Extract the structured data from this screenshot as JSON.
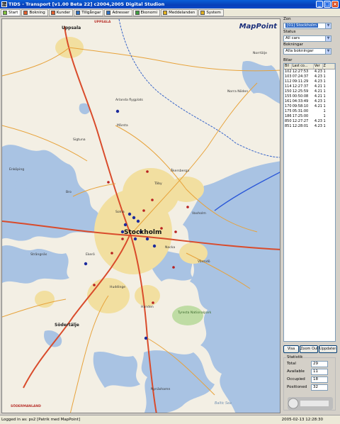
{
  "window": {
    "icon_text": "tis",
    "title": "TIDS - Transport [v1.00 Beta 22] c2004,2005 Digital Studion",
    "minimize": "_",
    "maximize": "□",
    "close": "×"
  },
  "tabs": [
    {
      "label": "Start",
      "color": "#7fbf3f"
    },
    {
      "label": "Bokning",
      "color": "#e06030"
    },
    {
      "label": "Kunder",
      "color": "#e06030"
    },
    {
      "label": "Tillgångar",
      "color": "#3070c0"
    },
    {
      "label": "Adresser",
      "color": "#3070c0"
    },
    {
      "label": "Ekonomi",
      "color": "#40a040"
    },
    {
      "label": "Meddelanden",
      "color": "#e0b020"
    },
    {
      "label": "System",
      "color": "#e0b020"
    }
  ],
  "map": {
    "logo": "MapPoint",
    "labels": {
      "uppsala": "Uppsala",
      "uppsala_county": "UPPSALA",
      "stockholm": "Stockholm",
      "arlanda": "Arlanda flygplats",
      "sodertalje": "Södertälje",
      "sodermanland": "SÖDERMANLAND",
      "tyresta": "Tyresta Nationalpark",
      "baltic": "Baltic Sea",
      "norrtalje": "Norrtälje",
      "marsta": "Märsta",
      "vaxholm": "Vaxholm",
      "nynashamn": "Nynäshamn",
      "haninge": "Handen",
      "taby": "Täby",
      "enkoping": "Enköping",
      "sigtuna": "Sigtuna",
      "akersberga": "Åkersberga",
      "varmdo": "Värmdö",
      "bro": "Bro",
      "huddinge": "Huddinge",
      "norrtalje_n": "Norra Nöden",
      "stbyholm": "Strängnäs",
      "ekero": "Ekerö",
      "solna": "Solna",
      "nacka": "Nacka"
    }
  },
  "panel": {
    "zon_label": "Zon",
    "zon_value": "[01] Stockholm",
    "status_label": "Status",
    "status_value": "All cars",
    "bokningar_label": "Bokningar",
    "bokningar_value": "Alla bokningar",
    "bilar_label": "Bilar",
    "car_columns": [
      "Bil",
      "Last co...",
      "Ver",
      "Z"
    ],
    "cars": [
      [
        "102",
        "12:27:53",
        "4.23",
        "1"
      ],
      [
        "103",
        "07:24:37",
        "4.23",
        "1"
      ],
      [
        "112",
        "09:11:29",
        "4.23",
        "1"
      ],
      [
        "114",
        "12:27:37",
        "4.21",
        "1"
      ],
      [
        "150",
        "12:25:59",
        "4.21",
        "1"
      ],
      [
        "155",
        "00:50:08",
        "4.21",
        "1"
      ],
      [
        "161",
        "04:33:49",
        "4.23",
        "1"
      ],
      [
        "170",
        "09:58:10",
        "4.21",
        "1"
      ],
      [
        "175",
        "05:31:00",
        "",
        "1"
      ],
      [
        "186",
        "17:25:00",
        "",
        "1"
      ],
      [
        "850",
        "12:27:27",
        "4.23",
        "1"
      ],
      [
        "851",
        "12:28:01",
        "4.23",
        "1"
      ]
    ],
    "buttons": [
      "Visa",
      "Zoom Out",
      "Uppdatera"
    ],
    "stats_title": "Statistik",
    "stats": [
      {
        "label": "Total",
        "value": "29"
      },
      {
        "label": "Available",
        "value": "11"
      },
      {
        "label": "Occupied",
        "value": "18"
      },
      {
        "label": "Positioned",
        "value": "32"
      }
    ]
  },
  "statusbar": {
    "left": "Logged in as: ps2 [Patrik med MapPoint]",
    "right": "2005-02-13 12:28:30"
  }
}
